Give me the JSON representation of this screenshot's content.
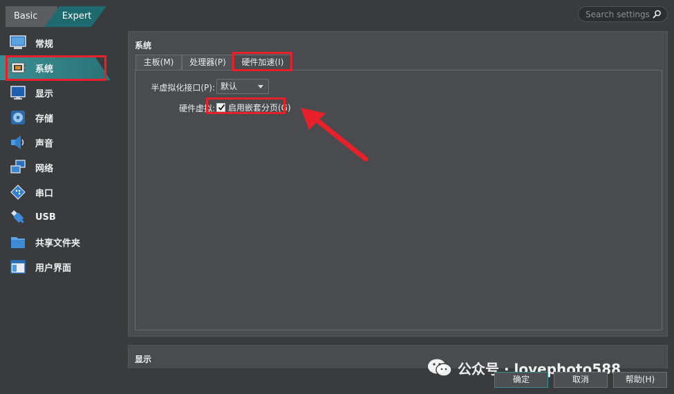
{
  "mode": {
    "basic_label": "Basic",
    "expert_label": "Expert",
    "active": "Expert"
  },
  "search": {
    "placeholder": "Search settings",
    "icon": "search-icon"
  },
  "sidebar": {
    "selected": "系统",
    "items": [
      {
        "label": "常规",
        "icon": "monitor-icon"
      },
      {
        "label": "系统",
        "icon": "chip-icon"
      },
      {
        "label": "显示",
        "icon": "display-icon"
      },
      {
        "label": "存储",
        "icon": "disk-icon"
      },
      {
        "label": "声音",
        "icon": "speaker-icon"
      },
      {
        "label": "网络",
        "icon": "network-icon"
      },
      {
        "label": "串口",
        "icon": "serial-port-icon"
      },
      {
        "label": "USB",
        "icon": "usb-icon"
      },
      {
        "label": "共享文件夹",
        "icon": "folder-icon"
      },
      {
        "label": "用户界面",
        "icon": "window-icon"
      }
    ]
  },
  "system_section": {
    "title": "系统",
    "tabs": [
      {
        "label": "主板(M)"
      },
      {
        "label": "处理器(P)"
      },
      {
        "label": "硬件加速(I)"
      }
    ],
    "active_tab": "硬件加速(I)",
    "paravirt_label": "半虚拟化接口(P):",
    "paravirt_value": "默认",
    "hw_virt_label": "硬件虚拟:",
    "nested_paging_label": "启用嵌套分页(G)",
    "nested_paging_checked": true
  },
  "display_section": {
    "title": "显示"
  },
  "buttons": {
    "ok": "确定",
    "cancel": "取消",
    "help": "帮助(H)"
  },
  "watermark": {
    "text": "公众号 · lovephoto588"
  },
  "colors": {
    "accent": "#2a7377",
    "annotation": "#e8202a",
    "background": "#3a3b3d",
    "panel": "#4a4b4e"
  }
}
